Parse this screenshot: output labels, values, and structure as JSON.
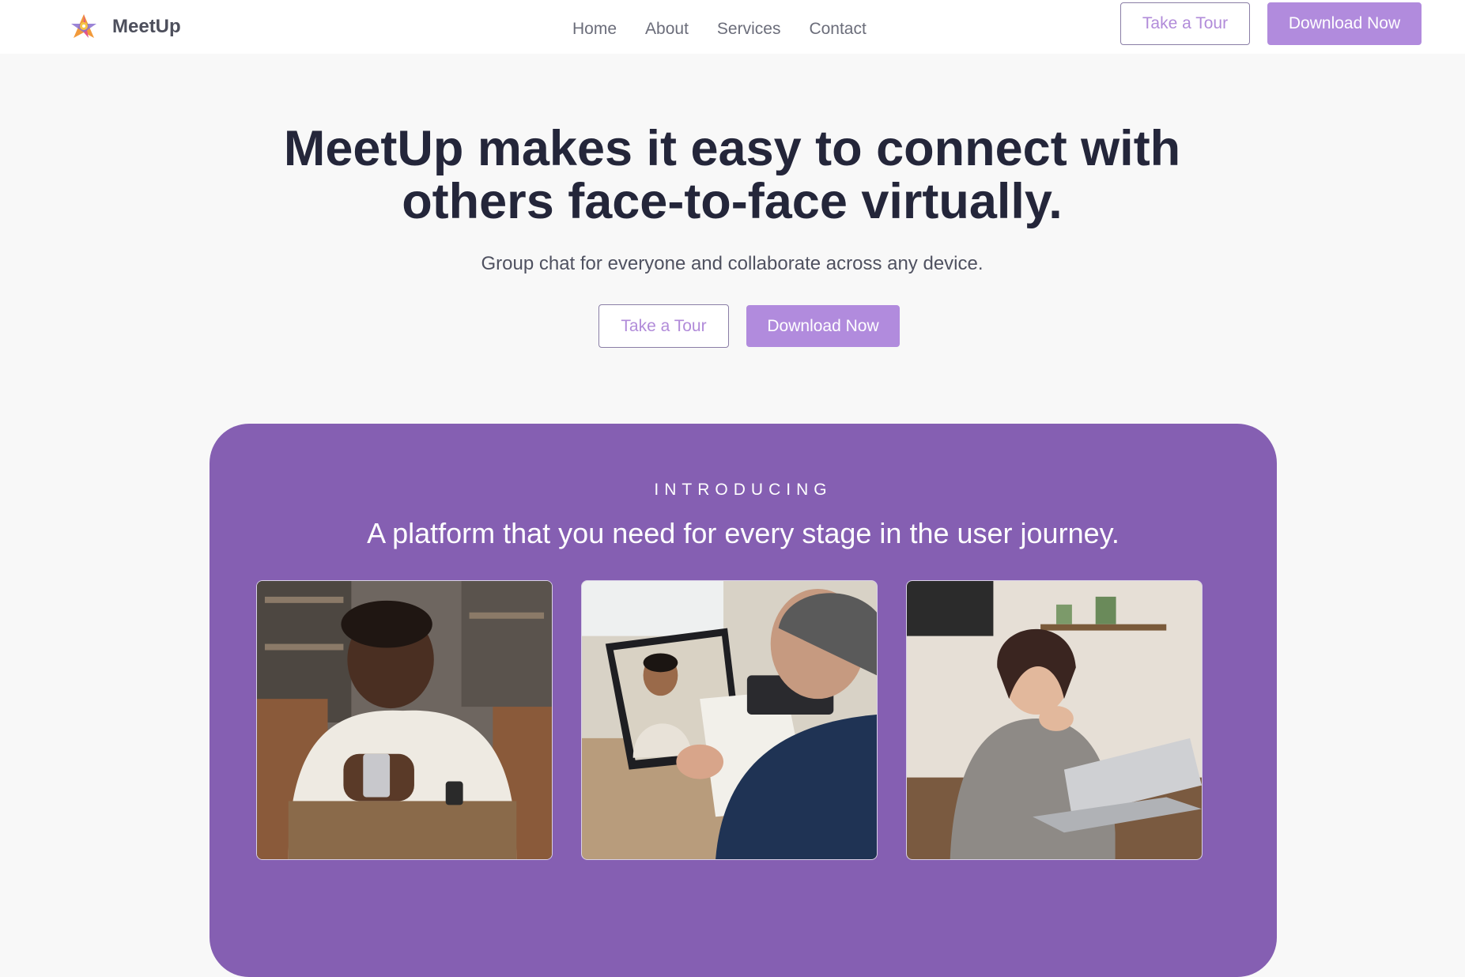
{
  "header": {
    "brand_name": "MeetUp",
    "logo_icon": "meetup-logo-icon",
    "nav": [
      {
        "label": "Home"
      },
      {
        "label": "About"
      },
      {
        "label": "Services"
      },
      {
        "label": "Contact"
      }
    ],
    "tour_label": "Take a Tour",
    "download_label": "Download Now"
  },
  "hero": {
    "title_line1": "MeetUp makes it easy to connect with",
    "title_line2": "others face-to-face virtually.",
    "subtitle": "Group chat for everyone and collaborate across any device.",
    "tour_label": "Take a Tour",
    "download_label": "Download Now"
  },
  "intro": {
    "eyebrow": "INTRODUCING",
    "heading": "A platform that you need for every stage in the user journey.",
    "photos": [
      {
        "name": "man-smiling-at-phone-photo"
      },
      {
        "name": "man-video-call-laptop-photo"
      },
      {
        "name": "woman-laughing-laptop-photo"
      }
    ]
  },
  "colors": {
    "accent": "#b18bdd",
    "panel": "#855fb2",
    "text_dark": "#24263a",
    "page_bg": "#f8f8f8"
  }
}
